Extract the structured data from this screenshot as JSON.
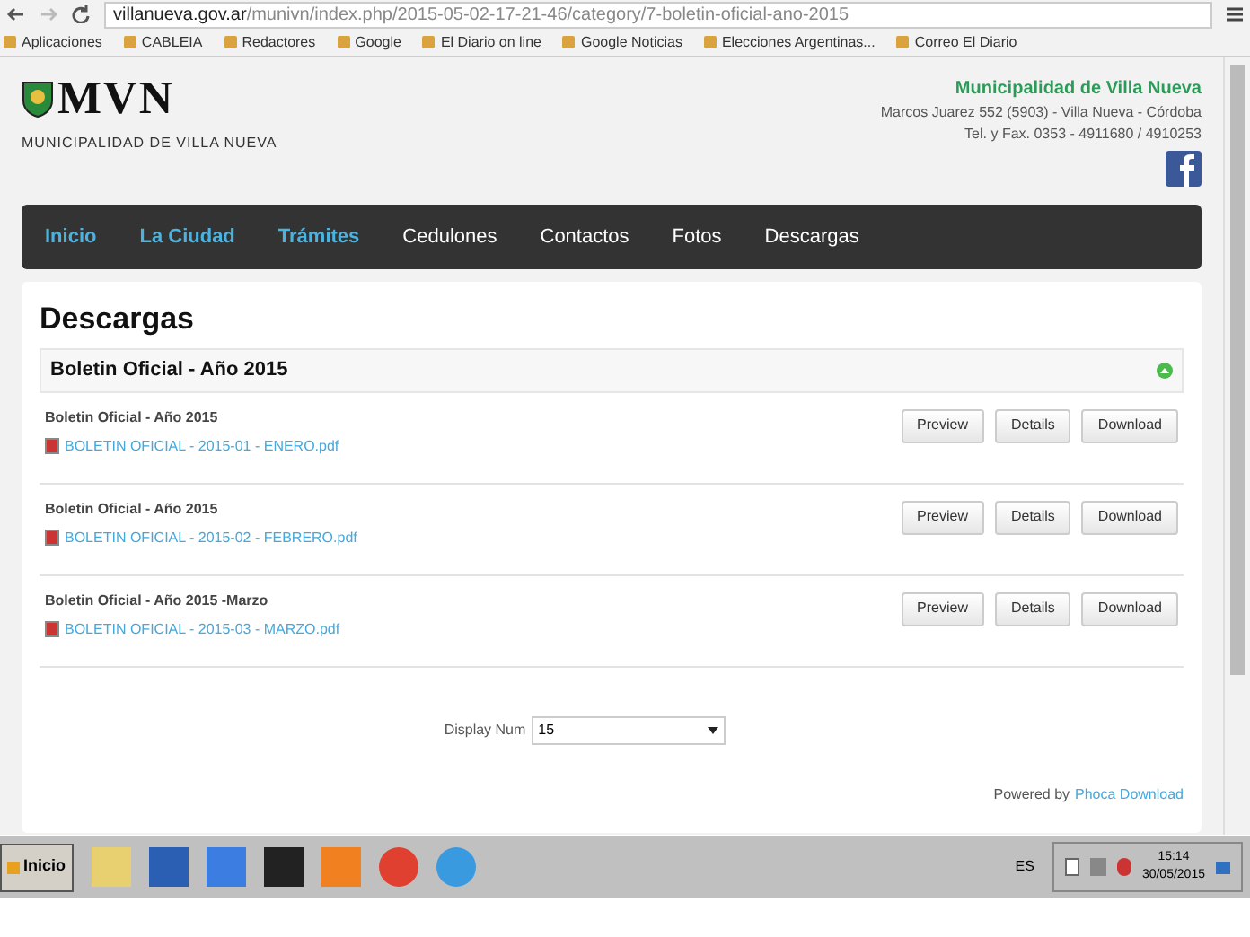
{
  "browser": {
    "url_host": "villanueva.gov.ar",
    "url_path": "/munivn/index.php/2015-05-02-17-21-46/category/7-boletin-oficial-ano-2015",
    "bookmarks": [
      "Aplicaciones",
      "CABLEIA",
      "Redactores",
      "Google",
      "El Diario on line",
      "Google Noticias",
      "Elecciones Argentinas...",
      "Correo El Diario"
    ]
  },
  "header": {
    "logo_text": "MVN",
    "logo_caption": "MUNICIPALIDAD DE VILLA NUEVA",
    "org_name": "Municipalidad de Villa Nueva",
    "address": "Marcos Juarez 552 (5903) - Villa Nueva - Córdoba",
    "phone": "Tel. y Fax. 0353 - 4911680 / 4910253"
  },
  "nav": [
    {
      "label": "Inicio",
      "highlighted": true
    },
    {
      "label": "La Ciudad",
      "highlighted": true
    },
    {
      "label": "Trámites",
      "highlighted": true
    },
    {
      "label": "Cedulones",
      "highlighted": false
    },
    {
      "label": "Contactos",
      "highlighted": false
    },
    {
      "label": "Fotos",
      "highlighted": false
    },
    {
      "label": "Descargas",
      "highlighted": false
    }
  ],
  "page_title": "Descargas",
  "category": "Boletin Oficial - Año 2015",
  "files": [
    {
      "title": "Boletin Oficial - Año 2015",
      "filename": "BOLETIN OFICIAL - 2015-01 - ENERO.pdf",
      "buttons": [
        "Preview",
        "Details",
        "Download"
      ]
    },
    {
      "title": "Boletin Oficial - Año 2015",
      "filename": "BOLETIN OFICIAL - 2015-02 - FEBRERO.pdf",
      "buttons": [
        "Preview",
        "Details",
        "Download"
      ]
    },
    {
      "title": "Boletin Oficial - Año 2015 -Marzo",
      "filename": "BOLETIN OFICIAL - 2015-03 - MARZO.pdf",
      "buttons": [
        "Preview",
        "Details",
        "Download"
      ]
    }
  ],
  "display_num": {
    "label": "Display Num",
    "value": "15"
  },
  "footer": {
    "powered_by": "Powered by",
    "link": "Phoca Download"
  },
  "taskbar": {
    "start": "Inicio",
    "language": "ES",
    "time": "15:14",
    "date": "30/05/2015"
  }
}
